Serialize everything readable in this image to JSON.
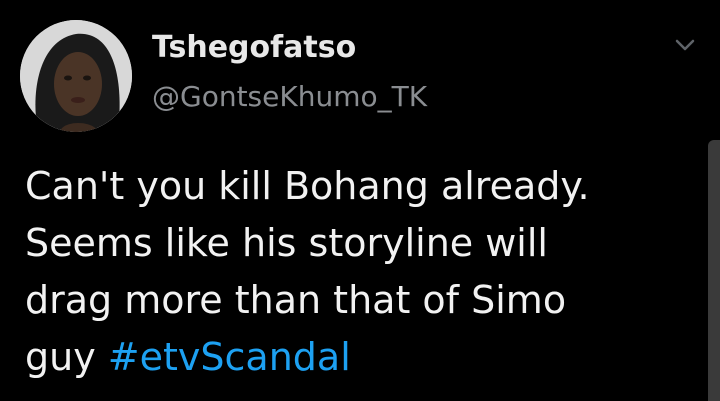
{
  "tweet": {
    "author": {
      "display_name": "Tshegofatso",
      "handle": "@GontseKhumo_TK"
    },
    "text_lines": [
      "Can't you kill Bohang already.",
      "Seems like his storyline will",
      "drag more than that of Simo",
      "guy"
    ],
    "hashtag": "#etvScandal"
  },
  "icons": {
    "avatar": "profile-photo",
    "menu": "chevron-down-icon"
  },
  "colors": {
    "background": "#000000",
    "text": "#f2f2f2",
    "handle": "#8a8d91",
    "hashtag": "#1da1f2"
  }
}
